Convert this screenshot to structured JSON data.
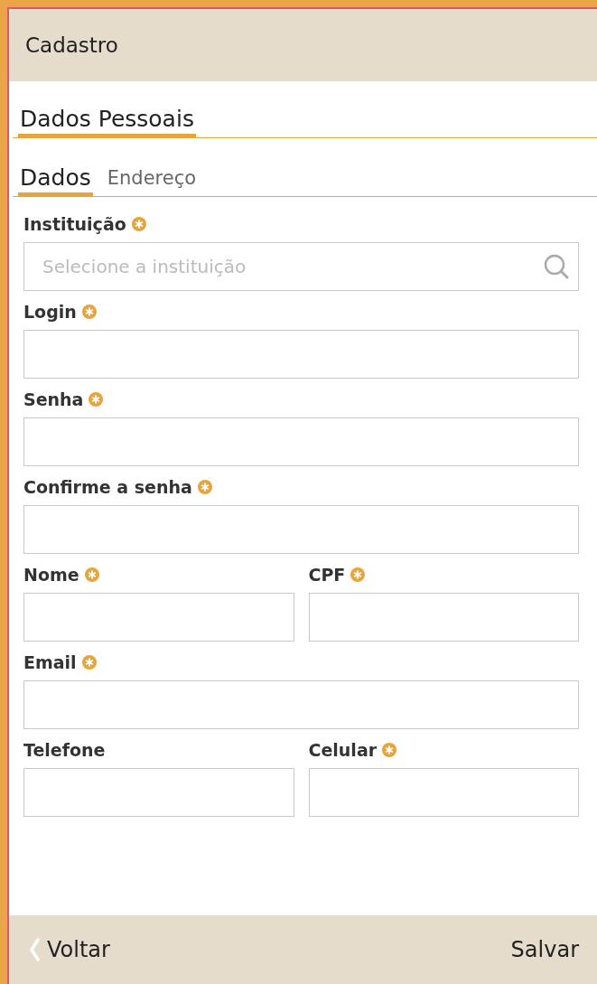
{
  "header": {
    "title": "Cadastro"
  },
  "section_tabs": [
    {
      "label": "Dados Pessoais",
      "selected": true
    }
  ],
  "sub_tabs": [
    {
      "label": "Dados",
      "selected": true
    },
    {
      "label": "Endereço",
      "selected": false
    }
  ],
  "form_rows": [
    [
      {
        "label": "Instituição",
        "required": true,
        "placeholder": "Selecione a instituição",
        "kind": "search"
      }
    ],
    [
      {
        "label": "Login",
        "required": true,
        "kind": "text"
      }
    ],
    [
      {
        "label": "Senha",
        "required": true,
        "kind": "password"
      }
    ],
    [
      {
        "label": "Confirme a senha",
        "required": true,
        "kind": "password"
      }
    ],
    [
      {
        "label": "Nome",
        "required": true,
        "kind": "text"
      },
      {
        "label": "CPF",
        "required": true,
        "kind": "text"
      }
    ],
    [
      {
        "label": "Email",
        "required": true,
        "kind": "text"
      }
    ],
    [
      {
        "label": "Telefone",
        "required": false,
        "kind": "text"
      },
      {
        "label": "Celular",
        "required": true,
        "kind": "text"
      }
    ]
  ],
  "footer": {
    "back": "Voltar",
    "save": "Salvar"
  }
}
